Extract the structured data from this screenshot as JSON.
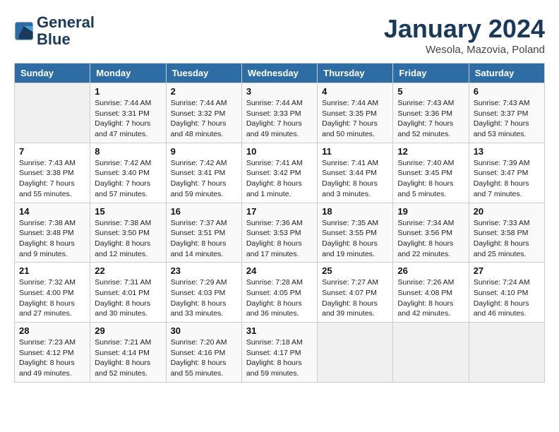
{
  "header": {
    "logo_line1": "General",
    "logo_line2": "Blue",
    "month": "January 2024",
    "location": "Wesola, Mazovia, Poland"
  },
  "weekdays": [
    "Sunday",
    "Monday",
    "Tuesday",
    "Wednesday",
    "Thursday",
    "Friday",
    "Saturday"
  ],
  "weeks": [
    [
      {
        "day": "",
        "info": ""
      },
      {
        "day": "1",
        "info": "Sunrise: 7:44 AM\nSunset: 3:31 PM\nDaylight: 7 hours\nand 47 minutes."
      },
      {
        "day": "2",
        "info": "Sunrise: 7:44 AM\nSunset: 3:32 PM\nDaylight: 7 hours\nand 48 minutes."
      },
      {
        "day": "3",
        "info": "Sunrise: 7:44 AM\nSunset: 3:33 PM\nDaylight: 7 hours\nand 49 minutes."
      },
      {
        "day": "4",
        "info": "Sunrise: 7:44 AM\nSunset: 3:35 PM\nDaylight: 7 hours\nand 50 minutes."
      },
      {
        "day": "5",
        "info": "Sunrise: 7:43 AM\nSunset: 3:36 PM\nDaylight: 7 hours\nand 52 minutes."
      },
      {
        "day": "6",
        "info": "Sunrise: 7:43 AM\nSunset: 3:37 PM\nDaylight: 7 hours\nand 53 minutes."
      }
    ],
    [
      {
        "day": "7",
        "info": "Sunrise: 7:43 AM\nSunset: 3:38 PM\nDaylight: 7 hours\nand 55 minutes."
      },
      {
        "day": "8",
        "info": "Sunrise: 7:42 AM\nSunset: 3:40 PM\nDaylight: 7 hours\nand 57 minutes."
      },
      {
        "day": "9",
        "info": "Sunrise: 7:42 AM\nSunset: 3:41 PM\nDaylight: 7 hours\nand 59 minutes."
      },
      {
        "day": "10",
        "info": "Sunrise: 7:41 AM\nSunset: 3:42 PM\nDaylight: 8 hours\nand 1 minute."
      },
      {
        "day": "11",
        "info": "Sunrise: 7:41 AM\nSunset: 3:44 PM\nDaylight: 8 hours\nand 3 minutes."
      },
      {
        "day": "12",
        "info": "Sunrise: 7:40 AM\nSunset: 3:45 PM\nDaylight: 8 hours\nand 5 minutes."
      },
      {
        "day": "13",
        "info": "Sunrise: 7:39 AM\nSunset: 3:47 PM\nDaylight: 8 hours\nand 7 minutes."
      }
    ],
    [
      {
        "day": "14",
        "info": "Sunrise: 7:38 AM\nSunset: 3:48 PM\nDaylight: 8 hours\nand 9 minutes."
      },
      {
        "day": "15",
        "info": "Sunrise: 7:38 AM\nSunset: 3:50 PM\nDaylight: 8 hours\nand 12 minutes."
      },
      {
        "day": "16",
        "info": "Sunrise: 7:37 AM\nSunset: 3:51 PM\nDaylight: 8 hours\nand 14 minutes."
      },
      {
        "day": "17",
        "info": "Sunrise: 7:36 AM\nSunset: 3:53 PM\nDaylight: 8 hours\nand 17 minutes."
      },
      {
        "day": "18",
        "info": "Sunrise: 7:35 AM\nSunset: 3:55 PM\nDaylight: 8 hours\nand 19 minutes."
      },
      {
        "day": "19",
        "info": "Sunrise: 7:34 AM\nSunset: 3:56 PM\nDaylight: 8 hours\nand 22 minutes."
      },
      {
        "day": "20",
        "info": "Sunrise: 7:33 AM\nSunset: 3:58 PM\nDaylight: 8 hours\nand 25 minutes."
      }
    ],
    [
      {
        "day": "21",
        "info": "Sunrise: 7:32 AM\nSunset: 4:00 PM\nDaylight: 8 hours\nand 27 minutes."
      },
      {
        "day": "22",
        "info": "Sunrise: 7:31 AM\nSunset: 4:01 PM\nDaylight: 8 hours\nand 30 minutes."
      },
      {
        "day": "23",
        "info": "Sunrise: 7:29 AM\nSunset: 4:03 PM\nDaylight: 8 hours\nand 33 minutes."
      },
      {
        "day": "24",
        "info": "Sunrise: 7:28 AM\nSunset: 4:05 PM\nDaylight: 8 hours\nand 36 minutes."
      },
      {
        "day": "25",
        "info": "Sunrise: 7:27 AM\nSunset: 4:07 PM\nDaylight: 8 hours\nand 39 minutes."
      },
      {
        "day": "26",
        "info": "Sunrise: 7:26 AM\nSunset: 4:08 PM\nDaylight: 8 hours\nand 42 minutes."
      },
      {
        "day": "27",
        "info": "Sunrise: 7:24 AM\nSunset: 4:10 PM\nDaylight: 8 hours\nand 46 minutes."
      }
    ],
    [
      {
        "day": "28",
        "info": "Sunrise: 7:23 AM\nSunset: 4:12 PM\nDaylight: 8 hours\nand 49 minutes."
      },
      {
        "day": "29",
        "info": "Sunrise: 7:21 AM\nSunset: 4:14 PM\nDaylight: 8 hours\nand 52 minutes."
      },
      {
        "day": "30",
        "info": "Sunrise: 7:20 AM\nSunset: 4:16 PM\nDaylight: 8 hours\nand 55 minutes."
      },
      {
        "day": "31",
        "info": "Sunrise: 7:18 AM\nSunset: 4:17 PM\nDaylight: 8 hours\nand 59 minutes."
      },
      {
        "day": "",
        "info": ""
      },
      {
        "day": "",
        "info": ""
      },
      {
        "day": "",
        "info": ""
      }
    ]
  ]
}
